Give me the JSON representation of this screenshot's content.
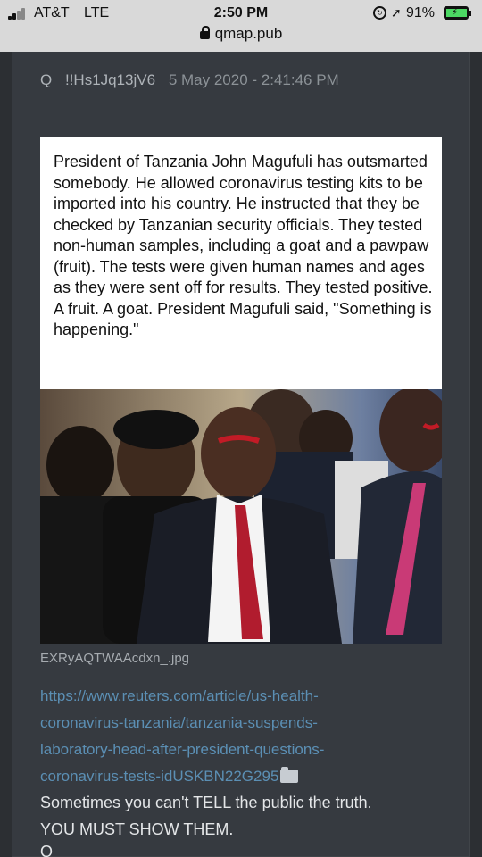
{
  "status_bar": {
    "carrier": "AT&T",
    "network": "LTE",
    "time": "2:50 PM",
    "battery_percent": "91%",
    "battery_level": 0.91,
    "icons": [
      "signal-icon",
      "rotation-lock-icon",
      "location-icon",
      "battery-charging-icon"
    ]
  },
  "browser": {
    "url": "qmap.pub",
    "icons": [
      "lock-icon"
    ]
  },
  "post": {
    "q_label": "Q",
    "tripcode": "!!Hs1Jq13jV6",
    "date": "5 May 2020 - 2:41:46 PM",
    "image_text": "President of Tanzania John Magufuli has outsmarted somebody. He allowed coronavirus testing kits to be imported into his country. He instructed that they be checked by Tanzanian security officials. They tested non-human samples, including a goat and a pawpaw (fruit). The tests were given human names and ages as they were sent off for results. They tested positive. A fruit. A goat. President Magufuli said, \"Something is happening.\"",
    "image_filename": "EXRyAQTWAAcdxn_.jpg",
    "link_lines": [
      "https://www.reuters.com/article/us-health-",
      "coronavirus-tanzania/tanzania-suspends-",
      "laboratory-head-after-president-questions-",
      "coronavirus-tests-idUSKBN22G295"
    ],
    "message_lines": [
      "Sometimes you can't TELL the public the truth.",
      "YOU MUST SHOW THEM."
    ],
    "signature": "Q",
    "colors": {
      "background": "#2c2f33",
      "card": "#363a40",
      "link": "#5b8fb4",
      "text": "#e4e6e8"
    }
  }
}
